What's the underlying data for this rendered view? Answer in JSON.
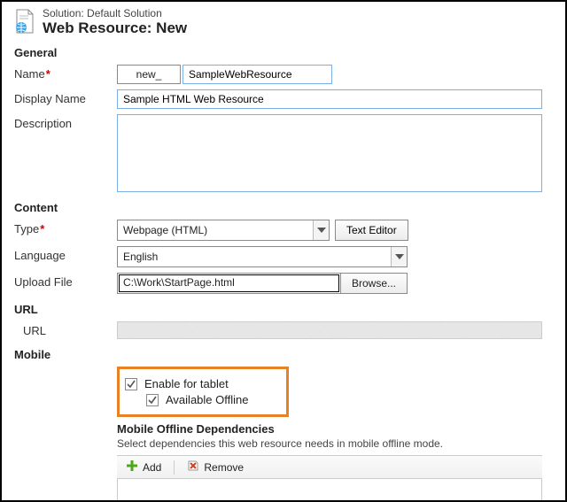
{
  "header": {
    "solution_label": "Solution:",
    "solution_name": "Default Solution",
    "page_title": "Web Resource: New"
  },
  "sections": {
    "general": "General",
    "content": "Content",
    "url": "URL",
    "mobile": "Mobile"
  },
  "general": {
    "name_label": "Name",
    "name_prefix": "new_",
    "name_value": "SampleWebResource",
    "display_name_label": "Display Name",
    "display_name_value": "Sample HTML Web Resource",
    "description_label": "Description",
    "description_value": ""
  },
  "content": {
    "type_label": "Type",
    "type_value": "Webpage (HTML)",
    "text_editor_btn": "Text Editor",
    "language_label": "Language",
    "language_value": "English",
    "upload_label": "Upload File",
    "upload_path": "C:\\Work\\StartPage.html",
    "browse_btn": "Browse..."
  },
  "url": {
    "url_label": "URL",
    "url_value": ""
  },
  "mobile": {
    "enable_tablet_label": "Enable for tablet",
    "enable_tablet_checked": true,
    "available_offline_label": "Available Offline",
    "available_offline_checked": true,
    "deps_title": "Mobile Offline Dependencies",
    "deps_desc": "Select dependencies this web resource needs in mobile offline mode.",
    "add_btn": "Add",
    "remove_btn": "Remove"
  }
}
